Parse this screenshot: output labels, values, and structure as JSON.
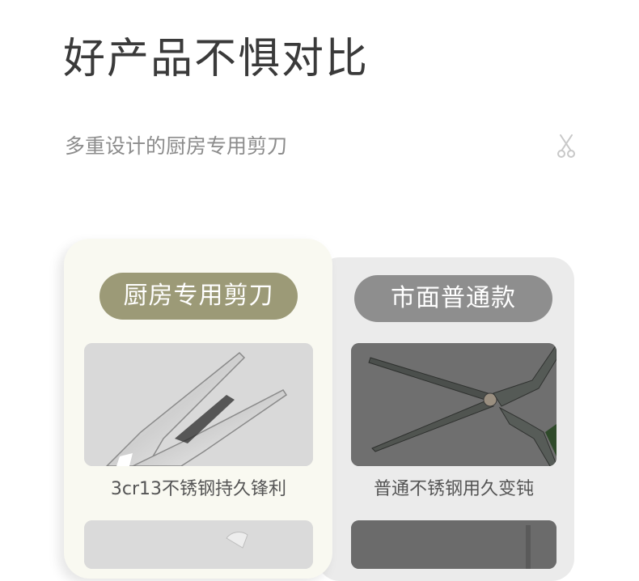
{
  "page": {
    "title": "好产品不惧对比",
    "subtitle": "多重设计的厨房专用剪刀"
  },
  "left_card": {
    "badge": "厨房专用剪刀",
    "feature_1": "3cr13不锈钢持久锋利"
  },
  "right_card": {
    "badge": "市面普通款",
    "feature_1": "普通不锈钢用久变钝"
  },
  "icons": {
    "header_mark": "scissors-icon"
  },
  "colors": {
    "left_badge": "#9c9a77",
    "right_badge": "#8e8e8e",
    "left_card_bg": "#f9f9f1",
    "right_card_bg": "#ebebeb",
    "title_text": "#3a3a3a",
    "subtitle_text": "#8c8c8c"
  }
}
